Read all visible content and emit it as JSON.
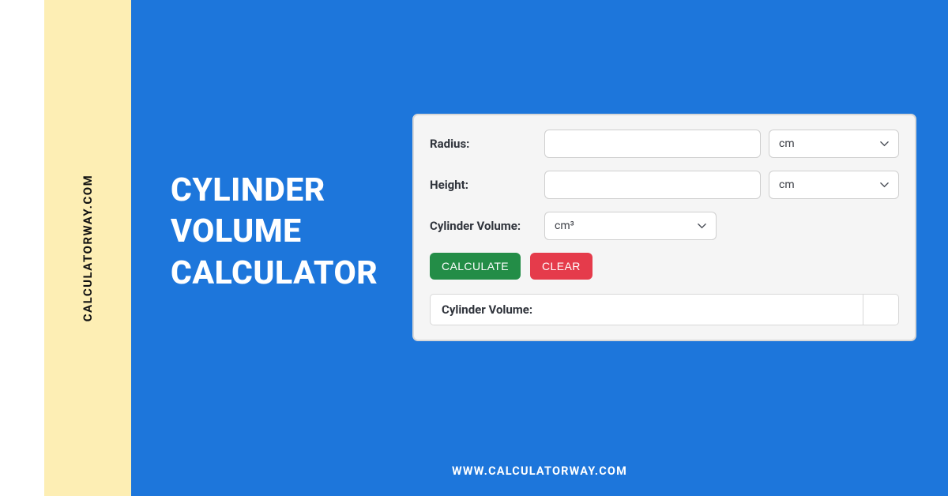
{
  "sidebar": {
    "vertical_text": "CALCULATORWAY.COM"
  },
  "main": {
    "title_line1": "CYLINDER",
    "title_line2": "VOLUME",
    "title_line3": "CALCULATOR"
  },
  "footer": {
    "url": "WWW.CALCULATORWAY.COM"
  },
  "calc": {
    "radius_label": "Radius:",
    "radius_value": "",
    "radius_unit": "cm",
    "height_label": "Height:",
    "height_value": "",
    "height_unit": "cm",
    "volume_select_label": "Cylinder Volume:",
    "volume_unit": "cm³",
    "calculate_label": "CALCULATE",
    "clear_label": "CLEAR",
    "result_label": "Cylinder Volume:",
    "result_value": ""
  },
  "colors": {
    "bg": "#1d76db",
    "yellow": "#fdeeb4",
    "green": "#238d47",
    "red": "#e53b4b"
  }
}
